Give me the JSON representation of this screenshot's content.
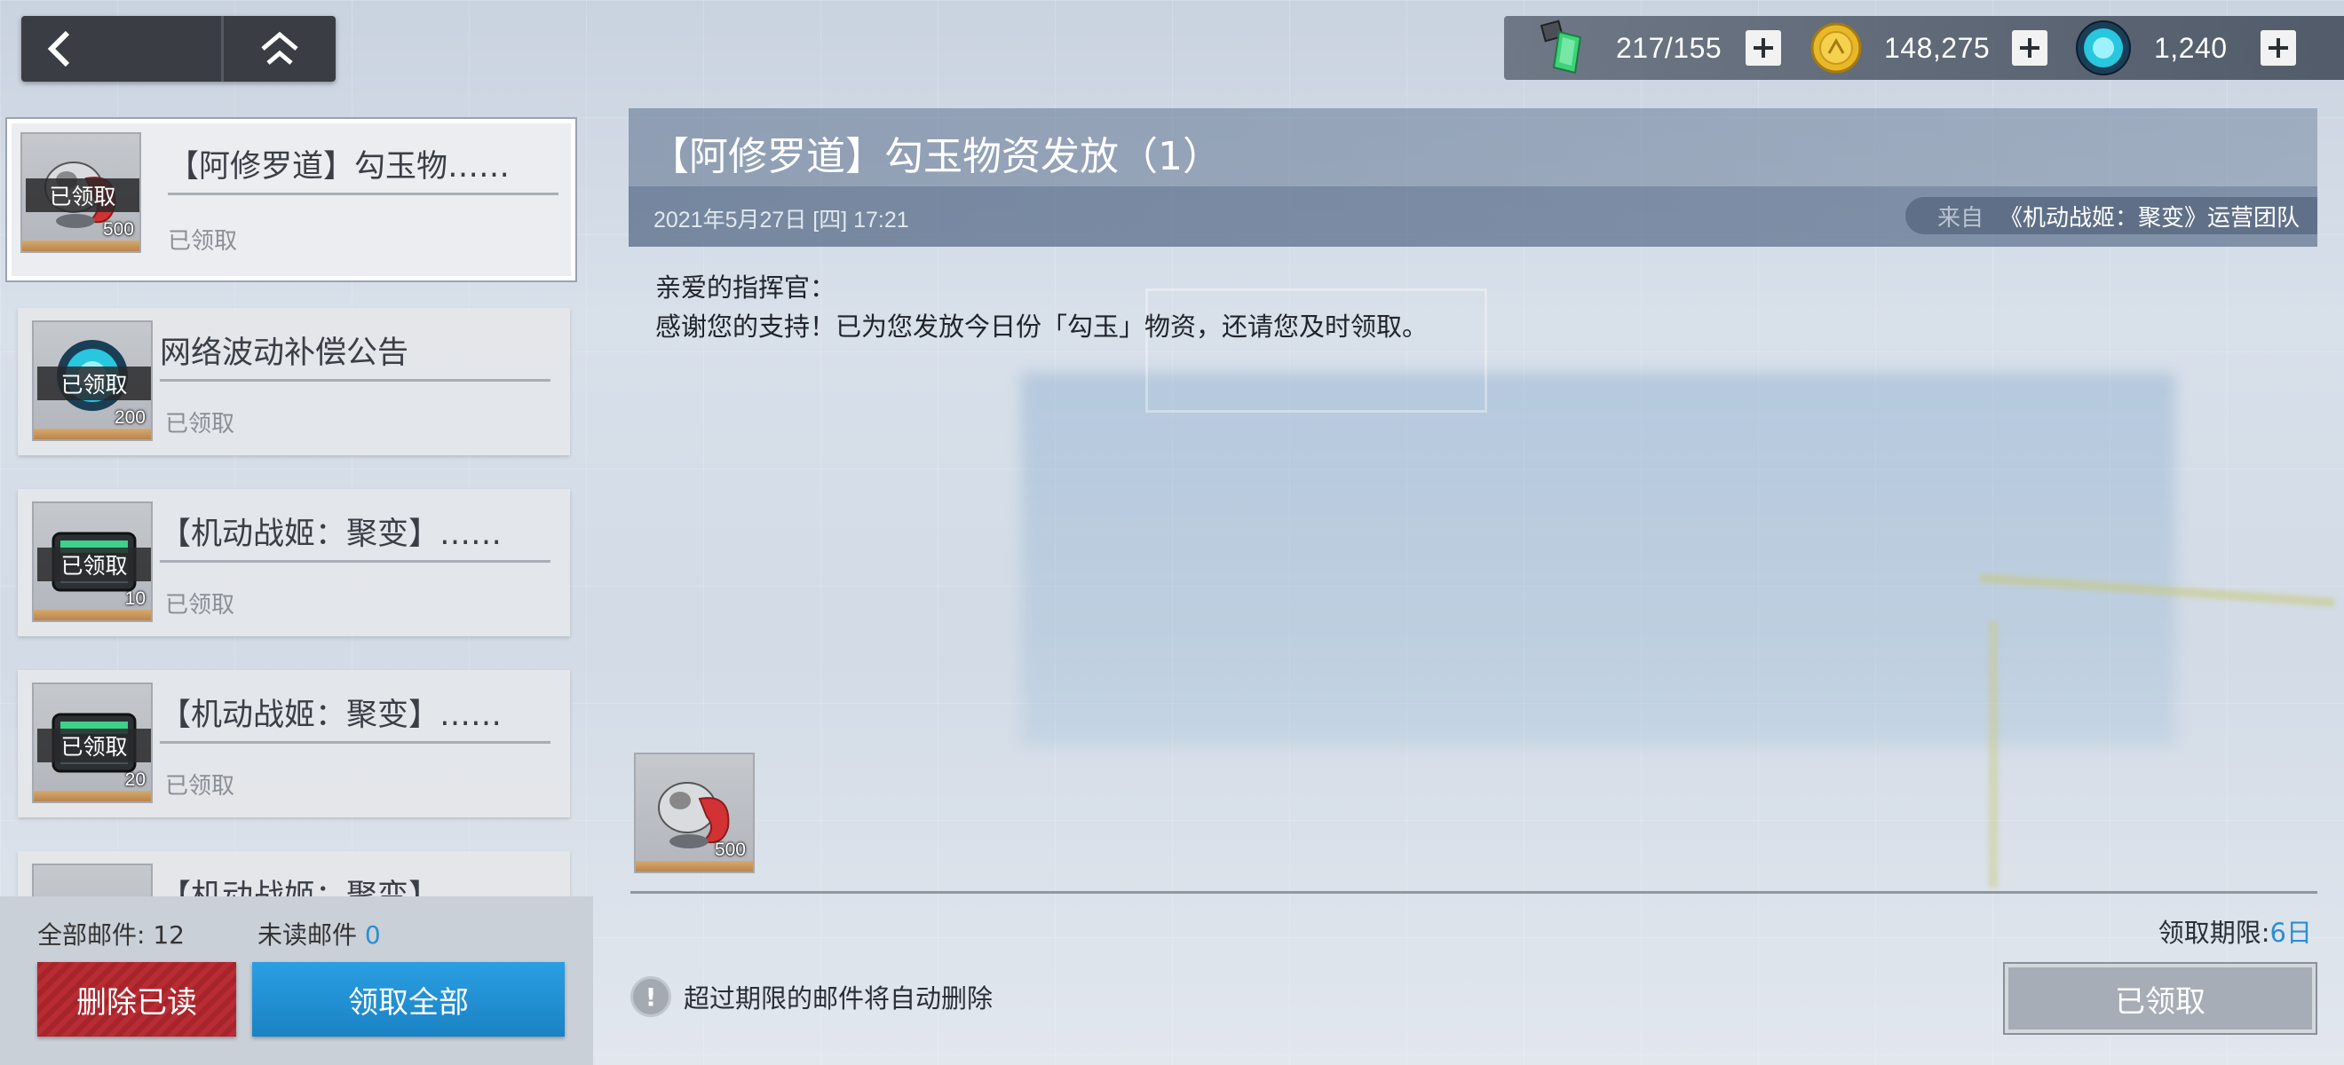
{
  "nav": {
    "back_icon": "chevron-left-icon",
    "home_icon": "home-icon"
  },
  "currencies": [
    {
      "name": "stamina",
      "icon": "green-crystal-icon",
      "value": "217/155"
    },
    {
      "name": "gold",
      "icon": "gold-coin-icon",
      "value": "148,275"
    },
    {
      "name": "gem",
      "icon": "cyan-gem-icon",
      "value": "1,240"
    }
  ],
  "mails": [
    {
      "title": "【阿修罗道】勾玉物……",
      "status": "已领取",
      "tag": "已领取",
      "qty": "500",
      "item": "magatama"
    },
    {
      "title": "网络波动补偿公告",
      "status": "已领取",
      "tag": "已领取",
      "qty": "200",
      "item": "cyan-gem"
    },
    {
      "title": "【机动战姬：聚变】……",
      "status": "已领取",
      "tag": "已领取",
      "qty": "10",
      "item": "ticket"
    },
    {
      "title": "【机动战姬：聚变】……",
      "status": "已领取",
      "tag": "已领取",
      "qty": "20",
      "item": "ticket"
    },
    {
      "title": "【机动战姬：聚变】……",
      "status": "",
      "tag": "",
      "qty": "",
      "item": ""
    }
  ],
  "summary": {
    "all_label": "全部邮件: 12",
    "unread_label": "未读邮件",
    "unread_count": "0"
  },
  "buttons": {
    "delete_read": "删除已读",
    "claim_all": "领取全部",
    "claimed": "已领取"
  },
  "detail": {
    "title": "【阿修罗道】勾玉物资发放（1）",
    "date": "2021年5月27日 [四] 17:21",
    "from_label": "来自",
    "from_name": "《机动战姬：聚变》运营团队",
    "greeting": "亲爱的指挥官：",
    "body": "感谢您的支持！已为您发放今日份「勾玉」物资，还请您及时领取。",
    "reward_qty": "500",
    "deadline_label": "领取期限:",
    "deadline_days": "6日",
    "notice": "超过期限的邮件将自动删除",
    "notice_icon": "!"
  },
  "colors": {
    "accent_blue": "#2a8fd0",
    "delete_red": "#b72d33",
    "claim_blue": "#1a82c4"
  }
}
